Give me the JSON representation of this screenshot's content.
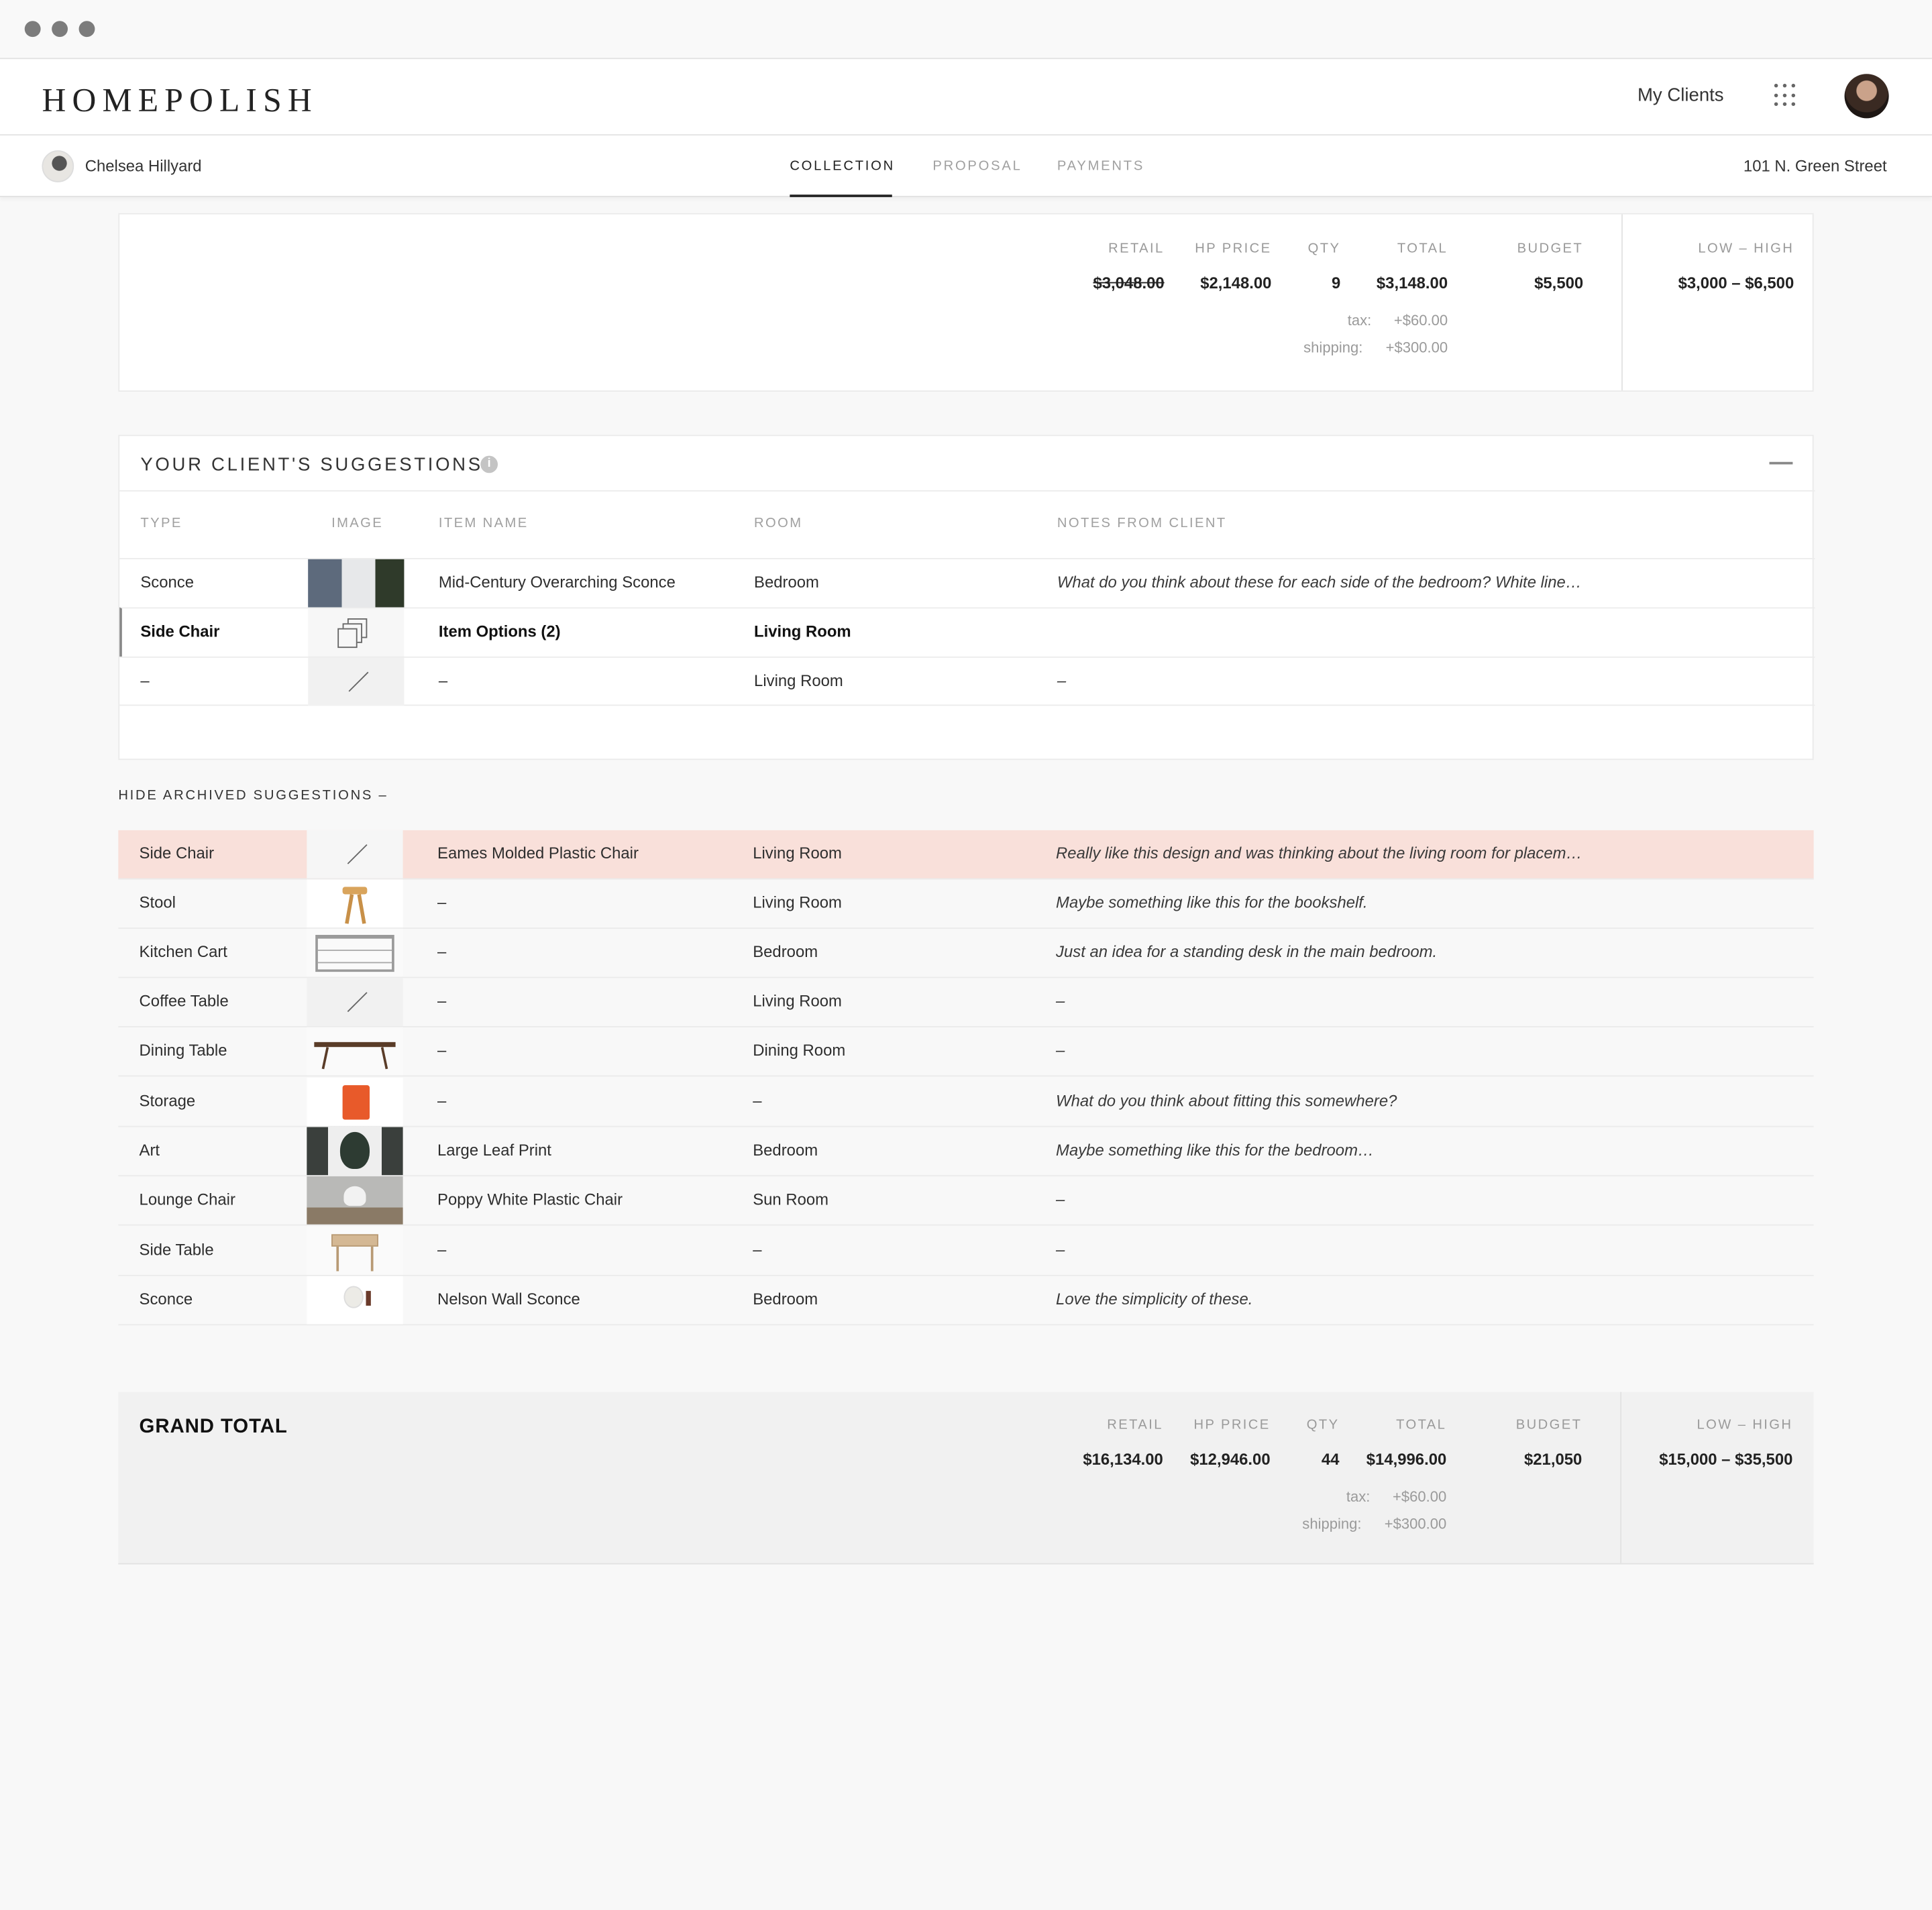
{
  "brand": {
    "logo": "HOMEPOLISH"
  },
  "header": {
    "my_clients": "My Clients"
  },
  "subnav": {
    "client_name": "Chelsea Hillyard",
    "tabs": [
      "COLLECTION",
      "PROPOSAL",
      "PAYMENTS"
    ],
    "active_tab": "COLLECTION",
    "address": "101 N. Green Street"
  },
  "room_summary": {
    "labels": {
      "retail": "RETAIL",
      "hp_price": "HP PRICE",
      "qty": "QTY",
      "total": "TOTAL",
      "budget": "BUDGET",
      "low_high": "LOW – HIGH"
    },
    "retail": "$3,048.00",
    "hp_price": "$2,148.00",
    "qty": "9",
    "total": "$3,148.00",
    "budget": "$5,500",
    "low_high": "$3,000 – $6,500",
    "tax_label": "tax:",
    "tax": "+$60.00",
    "shipping_label": "shipping:",
    "shipping": "+$300.00"
  },
  "suggestions": {
    "title": "YOUR CLIENT'S SUGGESTIONS",
    "info_glyph": "i",
    "columns": [
      "TYPE",
      "IMAGE",
      "ITEM NAME",
      "ROOM",
      "NOTES FROM CLIENT"
    ],
    "rows": [
      {
        "type": "Sconce",
        "image": "sconce-photo",
        "item": "Mid-Century Overarching Sconce",
        "room": "Bedroom",
        "notes": "What do you think about these for each side of the bedroom? White line…"
      },
      {
        "type": "Side Chair",
        "image": "item-options-icon",
        "item": "Item Options (2)",
        "room": "Living Room",
        "notes": ""
      },
      {
        "type": "–",
        "image": "no-image-icon",
        "item": "–",
        "room": "Living Room",
        "notes": "–"
      }
    ]
  },
  "archived": {
    "toggle_label": "HIDE ARCHIVED SUGGESTIONS –",
    "rows": [
      {
        "type": "Side Chair",
        "image": "no-image-icon",
        "item": "Eames Molded Plastic Chair",
        "room": "Living Room",
        "notes": "Really like this design and was thinking about the living room for placem…"
      },
      {
        "type": "Stool",
        "image": "stool-photo",
        "item": "–",
        "room": "Living Room",
        "notes": "Maybe something like this for the bookshelf."
      },
      {
        "type": "Kitchen Cart",
        "image": "kitchen-cart-photo",
        "item": "–",
        "room": "Bedroom",
        "notes": "Just an idea for a standing desk in the main bedroom."
      },
      {
        "type": "Coffee Table",
        "image": "no-image-icon",
        "item": "–",
        "room": "Living Room",
        "notes": "–"
      },
      {
        "type": "Dining Table",
        "image": "dining-table-photo",
        "item": "–",
        "room": "Dining Room",
        "notes": "–"
      },
      {
        "type": "Storage",
        "image": "storage-photo",
        "item": "–",
        "room": "–",
        "notes": "What do you think about fitting this somewhere?"
      },
      {
        "type": "Art",
        "image": "leaf-print-photo",
        "item": "Large Leaf Print",
        "room": "Bedroom",
        "notes": "Maybe something like this for the bedroom…"
      },
      {
        "type": "Lounge Chair",
        "image": "lounge-chair-photo",
        "item": "Poppy White Plastic Chair",
        "room": "Sun Room",
        "notes": "–"
      },
      {
        "type": "Side Table",
        "image": "side-table-photo",
        "item": "–",
        "room": "–",
        "notes": "–"
      },
      {
        "type": "Sconce",
        "image": "wall-sconce-photo",
        "item": "Nelson Wall Sconce",
        "room": "Bedroom",
        "notes": "Love the simplicity of these."
      }
    ]
  },
  "grand_total": {
    "title": "GRAND TOTAL",
    "labels": {
      "retail": "RETAIL",
      "hp_price": "HP PRICE",
      "qty": "QTY",
      "total": "TOTAL",
      "budget": "BUDGET",
      "low_high": "LOW – HIGH"
    },
    "retail": "$16,134.00",
    "hp_price": "$12,946.00",
    "qty": "44",
    "total": "$14,996.00",
    "budget": "$21,050",
    "low_high": "$15,000 – $35,500",
    "tax_label": "tax:",
    "tax": "+$60.00",
    "shipping_label": "shipping:",
    "shipping": "+$300.00"
  },
  "colors": {
    "highlight_row": "#f9e0da",
    "storage_orange": "#e85a2a",
    "text": "#2a2a2a"
  }
}
